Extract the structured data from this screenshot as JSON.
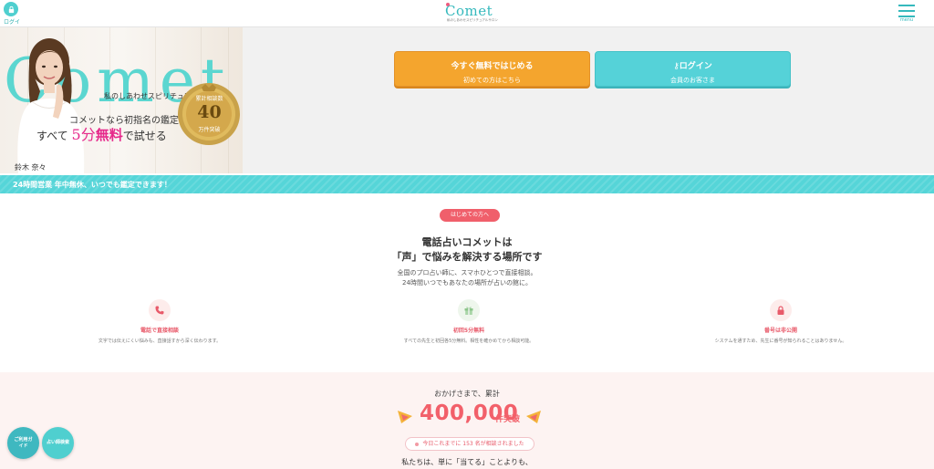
{
  "header": {
    "login_label": "ログイン",
    "logo": "Comet",
    "logo_tagline": "私のしあわせスピリチュアルサロン",
    "menu_label": "menu"
  },
  "hero": {
    "banner": {
      "brand": "Comet",
      "tagline": "私のしあわせスピリチュアルサロン",
      "line1": "コメットなら初指名の鑑定を",
      "line2_prefix": "すべて",
      "line2_highlight1": "5分",
      "line2_highlight2": "無料",
      "line2_suffix": "で試せる",
      "medal_label": "累計相談数",
      "medal_number": "40",
      "medal_unit": "万件突破",
      "person_name": "鈴木 奈々"
    },
    "cta_primary": {
      "main": "今すぐ無料ではじめる",
      "sub": "初めての方はこちら"
    },
    "cta_secondary": {
      "icon": "key-icon",
      "main": "ログイン",
      "sub": "会員のお客さま"
    }
  },
  "announcement": "24時間営業 年中無休、いつでも鑑定できます！",
  "intro": {
    "badge": "はじめての方へ",
    "title_line1": "電話占いコメットは",
    "title_line2": "「声」で悩みを解決する場所です",
    "body_line1": "全国のプロ占い師に、スマホひとつで直接相談。",
    "body_line2": "24時間いつでもあなたの場所が占いの館に。",
    "features": [
      {
        "icon": "phone-icon",
        "title": "電話で直接相談",
        "desc": "文字では伝えにくい悩みも、直接話すから深く伝わります。"
      },
      {
        "icon": "gift-icon",
        "title": "初回5分無料",
        "desc": "すべての先生と初回各5分無料。相性を確かめてから相談可能。"
      },
      {
        "icon": "lock-icon",
        "title": "番号は非公開",
        "desc": "システムを通すため、先生に番号が知られることはありません。"
      }
    ]
  },
  "stats": {
    "lead": "おかげさまで、累計",
    "number": "400,000",
    "unit": "件突破",
    "counter": "今日これまでに 153 名が相談されました",
    "tail": "私たちは、単に「当てる」ことよりも、"
  },
  "floating": {
    "guide_label": "ご利用ガイド",
    "fortune_label": "占い師検索"
  },
  "colors": {
    "teal": "#55d2d8",
    "orange": "#f4a52e",
    "pink": "#f05f6b",
    "magenta": "#e6298b"
  }
}
